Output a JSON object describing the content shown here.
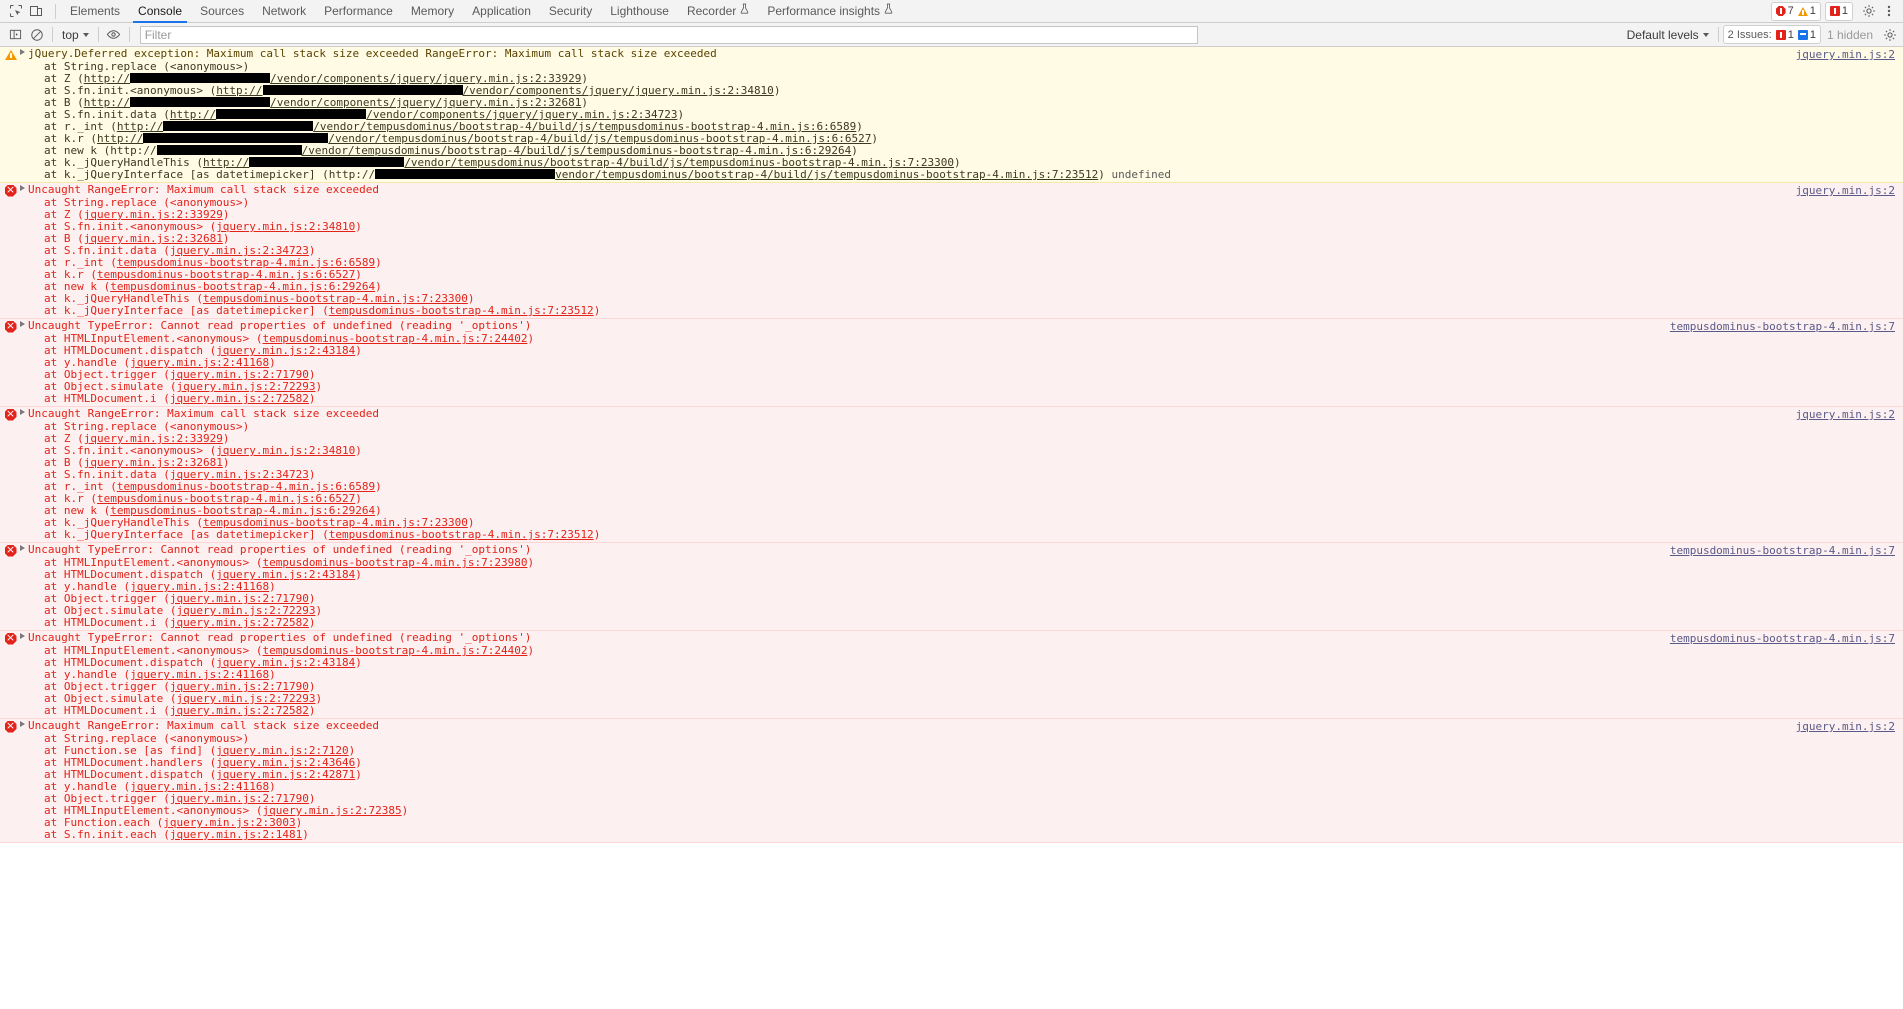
{
  "tabbar": {
    "icons": [
      {
        "name": "inspect-element-icon",
        "glyph": "inspect"
      },
      {
        "name": "device-toolbar-icon",
        "glyph": "device"
      }
    ],
    "tabs": [
      {
        "label": "Elements",
        "active": false
      },
      {
        "label": "Console",
        "active": true
      },
      {
        "label": "Sources",
        "active": false
      },
      {
        "label": "Network",
        "active": false
      },
      {
        "label": "Performance",
        "active": false
      },
      {
        "label": "Memory",
        "active": false
      },
      {
        "label": "Application",
        "active": false
      },
      {
        "label": "Security",
        "active": false
      },
      {
        "label": "Lighthouse",
        "active": false
      },
      {
        "label": "Recorder",
        "active": false,
        "badge": "flask"
      },
      {
        "label": "Performance insights",
        "active": false,
        "badge": "flask"
      }
    ],
    "counters": {
      "errors": "7",
      "warnings": "1",
      "issues": "1"
    },
    "settings_label": "Settings",
    "more_label": "More options"
  },
  "console_toolbar": {
    "clear_console_label": "Clear console",
    "sidebar_label": "Console sidebar",
    "context_selector": "top",
    "live_expression_label": "Create live expression",
    "filter_placeholder": "Filter",
    "filter_value": "",
    "levels_label": "Default levels",
    "issues_label": "2 Issues:",
    "issues_error_count": "1",
    "issues_info_count": "1",
    "hidden_label": "1 hidden",
    "settings_label": "Console settings"
  },
  "messages": [
    {
      "level": "warning",
      "title": "jQuery.Deferred exception: Maximum call stack size exceeded RangeError: Maximum call stack size exceeded",
      "source": "jquery.min.js:2",
      "stack": [
        {
          "text": "at String.replace (<anonymous>)"
        },
        {
          "prefix": "at Z (",
          "link": "http://",
          "redact": 140,
          "path": "/vendor/components/jquery/jquery.min.js:2:33929",
          "suffix": ")"
        },
        {
          "prefix": "at S.fn.init.<anonymous> (",
          "link": "http://",
          "redact": 200,
          "path": "/vendor/components/jquery/jquery.min.js:2:34810",
          "suffix": ")"
        },
        {
          "prefix": "at B (",
          "link": "http://",
          "redact": 140,
          "path": "/vendor/components/jquery/jquery.min.js:2:32681",
          "suffix": ")"
        },
        {
          "prefix": "at S.fn.init.data (",
          "link": "http://",
          "redact": 150,
          "path": "/vendor/components/jquery/jquery.min.js:2:34723",
          "suffix": ")"
        },
        {
          "prefix": "at r._int (",
          "link": "http://",
          "redact": 150,
          "path": "/vendor/tempusdominus/bootstrap-4/build/js/tempusdominus-bootstrap-4.min.js:6:6589",
          "suffix": ")"
        },
        {
          "prefix": "at k.r (",
          "link": "http://",
          "redact": 185,
          "path": "/vendor/tempusdominus/bootstrap-4/build/js/tempusdominus-bootstrap-4.min.js:6:6527",
          "suffix": ")"
        },
        {
          "prefix": "at new k (http://",
          "redact": 145,
          "path": "/vendor/tempusdominus/bootstrap-4/build/js/tempusdominus-bootstrap-4.min.js:6:29264",
          "suffix": ")",
          "plain": true
        },
        {
          "prefix": "at k._jQueryHandleThis (",
          "link": "http://",
          "redact": 155,
          "path": "/vendor/tempusdominus/bootstrap-4/build/js/tempusdominus-bootstrap-4.min.js:7:23300",
          "suffix": ")"
        },
        {
          "prefix": "at k._jQueryInterface [as datetimepicker] (http://",
          "redact": 180,
          "path": "vendor/tempusdominus/bootstrap-4/build/js/tempusdominus-bootstrap-4.min.js:7:23512",
          "suffix": ")",
          "tail": " undefined",
          "plain": true
        }
      ]
    },
    {
      "level": "error",
      "title": "Uncaught RangeError: Maximum call stack size exceeded",
      "source": "jquery.min.js:2",
      "stack": [
        {
          "text": "at String.replace (<anonymous>)"
        },
        {
          "prefix": "at Z (",
          "path": "jquery.min.js:2:33929",
          "suffix": ")"
        },
        {
          "prefix": "at S.fn.init.<anonymous> (",
          "path": "jquery.min.js:2:34810",
          "suffix": ")"
        },
        {
          "prefix": "at B (",
          "path": "jquery.min.js:2:32681",
          "suffix": ")"
        },
        {
          "prefix": "at S.fn.init.data (",
          "path": "jquery.min.js:2:34723",
          "suffix": ")"
        },
        {
          "prefix": "at r._int (",
          "path": "tempusdominus-bootstrap-4.min.js:6:6589",
          "suffix": ")"
        },
        {
          "prefix": "at k.r (",
          "path": "tempusdominus-bootstrap-4.min.js:6:6527",
          "suffix": ")"
        },
        {
          "prefix": "at new k (",
          "path": "tempusdominus-bootstrap-4.min.js:6:29264",
          "suffix": ")"
        },
        {
          "prefix": "at k._jQueryHandleThis (",
          "path": "tempusdominus-bootstrap-4.min.js:7:23300",
          "suffix": ")"
        },
        {
          "prefix": "at k._jQueryInterface [as datetimepicker] (",
          "path": "tempusdominus-bootstrap-4.min.js:7:23512",
          "suffix": ")"
        }
      ]
    },
    {
      "level": "error",
      "title": "Uncaught TypeError: Cannot read properties of undefined (reading '_options')",
      "source": "tempusdominus-bootstrap-4.min.js:7",
      "stack": [
        {
          "prefix": "at HTMLInputElement.<anonymous> (",
          "path": "tempusdominus-bootstrap-4.min.js:7:24402",
          "suffix": ")"
        },
        {
          "prefix": "at HTMLDocument.dispatch (",
          "path": "jquery.min.js:2:43184",
          "suffix": ")"
        },
        {
          "prefix": "at y.handle (",
          "path": "jquery.min.js:2:41168",
          "suffix": ")"
        },
        {
          "prefix": "at Object.trigger (",
          "path": "jquery.min.js:2:71790",
          "suffix": ")"
        },
        {
          "prefix": "at Object.simulate (",
          "path": "jquery.min.js:2:72293",
          "suffix": ")"
        },
        {
          "prefix": "at HTMLDocument.i (",
          "path": "jquery.min.js:2:72582",
          "suffix": ")"
        }
      ]
    },
    {
      "level": "error",
      "title": "Uncaught RangeError: Maximum call stack size exceeded",
      "source": "jquery.min.js:2",
      "stack": [
        {
          "text": "at String.replace (<anonymous>)"
        },
        {
          "prefix": "at Z (",
          "path": "jquery.min.js:2:33929",
          "suffix": ")"
        },
        {
          "prefix": "at S.fn.init.<anonymous> (",
          "path": "jquery.min.js:2:34810",
          "suffix": ")"
        },
        {
          "prefix": "at B (",
          "path": "jquery.min.js:2:32681",
          "suffix": ")"
        },
        {
          "prefix": "at S.fn.init.data (",
          "path": "jquery.min.js:2:34723",
          "suffix": ")"
        },
        {
          "prefix": "at r._int (",
          "path": "tempusdominus-bootstrap-4.min.js:6:6589",
          "suffix": ")"
        },
        {
          "prefix": "at k.r (",
          "path": "tempusdominus-bootstrap-4.min.js:6:6527",
          "suffix": ")"
        },
        {
          "prefix": "at new k (",
          "path": "tempusdominus-bootstrap-4.min.js:6:29264",
          "suffix": ")"
        },
        {
          "prefix": "at k._jQueryHandleThis (",
          "path": "tempusdominus-bootstrap-4.min.js:7:23300",
          "suffix": ")"
        },
        {
          "prefix": "at k._jQueryInterface [as datetimepicker] (",
          "path": "tempusdominus-bootstrap-4.min.js:7:23512",
          "suffix": ")"
        }
      ]
    },
    {
      "level": "error",
      "title": "Uncaught TypeError: Cannot read properties of undefined (reading '_options')",
      "source": "tempusdominus-bootstrap-4.min.js:7",
      "stack": [
        {
          "prefix": "at HTMLInputElement.<anonymous> (",
          "path": "tempusdominus-bootstrap-4.min.js:7:23980",
          "suffix": ")"
        },
        {
          "prefix": "at HTMLDocument.dispatch (",
          "path": "jquery.min.js:2:43184",
          "suffix": ")"
        },
        {
          "prefix": "at y.handle (",
          "path": "jquery.min.js:2:41168",
          "suffix": ")"
        },
        {
          "prefix": "at Object.trigger (",
          "path": "jquery.min.js:2:71790",
          "suffix": ")"
        },
        {
          "prefix": "at Object.simulate (",
          "path": "jquery.min.js:2:72293",
          "suffix": ")"
        },
        {
          "prefix": "at HTMLDocument.i (",
          "path": "jquery.min.js:2:72582",
          "suffix": ")"
        }
      ]
    },
    {
      "level": "error",
      "title": "Uncaught TypeError: Cannot read properties of undefined (reading '_options')",
      "source": "tempusdominus-bootstrap-4.min.js:7",
      "stack": [
        {
          "prefix": "at HTMLInputElement.<anonymous> (",
          "path": "tempusdominus-bootstrap-4.min.js:7:24402",
          "suffix": ")"
        },
        {
          "prefix": "at HTMLDocument.dispatch (",
          "path": "jquery.min.js:2:43184",
          "suffix": ")"
        },
        {
          "prefix": "at y.handle (",
          "path": "jquery.min.js:2:41168",
          "suffix": ")"
        },
        {
          "prefix": "at Object.trigger (",
          "path": "jquery.min.js:2:71790",
          "suffix": ")"
        },
        {
          "prefix": "at Object.simulate (",
          "path": "jquery.min.js:2:72293",
          "suffix": ")"
        },
        {
          "prefix": "at HTMLDocument.i (",
          "path": "jquery.min.js:2:72582",
          "suffix": ")"
        }
      ]
    },
    {
      "level": "error",
      "title": "Uncaught RangeError: Maximum call stack size exceeded",
      "source": "jquery.min.js:2",
      "stack": [
        {
          "text": "at String.replace (<anonymous>)"
        },
        {
          "prefix": "at Function.se [as find] (",
          "path": "jquery.min.js:2:7120",
          "suffix": ")"
        },
        {
          "prefix": "at HTMLDocument.handlers (",
          "path": "jquery.min.js:2:43646",
          "suffix": ")"
        },
        {
          "prefix": "at HTMLDocument.dispatch (",
          "path": "jquery.min.js:2:42871",
          "suffix": ")"
        },
        {
          "prefix": "at y.handle (",
          "path": "jquery.min.js:2:41168",
          "suffix": ")"
        },
        {
          "prefix": "at Object.trigger (",
          "path": "jquery.min.js:2:71790",
          "suffix": ")"
        },
        {
          "prefix": "at HTMLInputElement.<anonymous> (",
          "path": "jquery.min.js:2:72385",
          "suffix": ")"
        },
        {
          "prefix": "at Function.each (",
          "path": "jquery.min.js:2:3003",
          "suffix": ")"
        },
        {
          "prefix": "at S.fn.init.each (",
          "path": "jquery.min.js:2:1481",
          "suffix": ")"
        }
      ]
    }
  ]
}
